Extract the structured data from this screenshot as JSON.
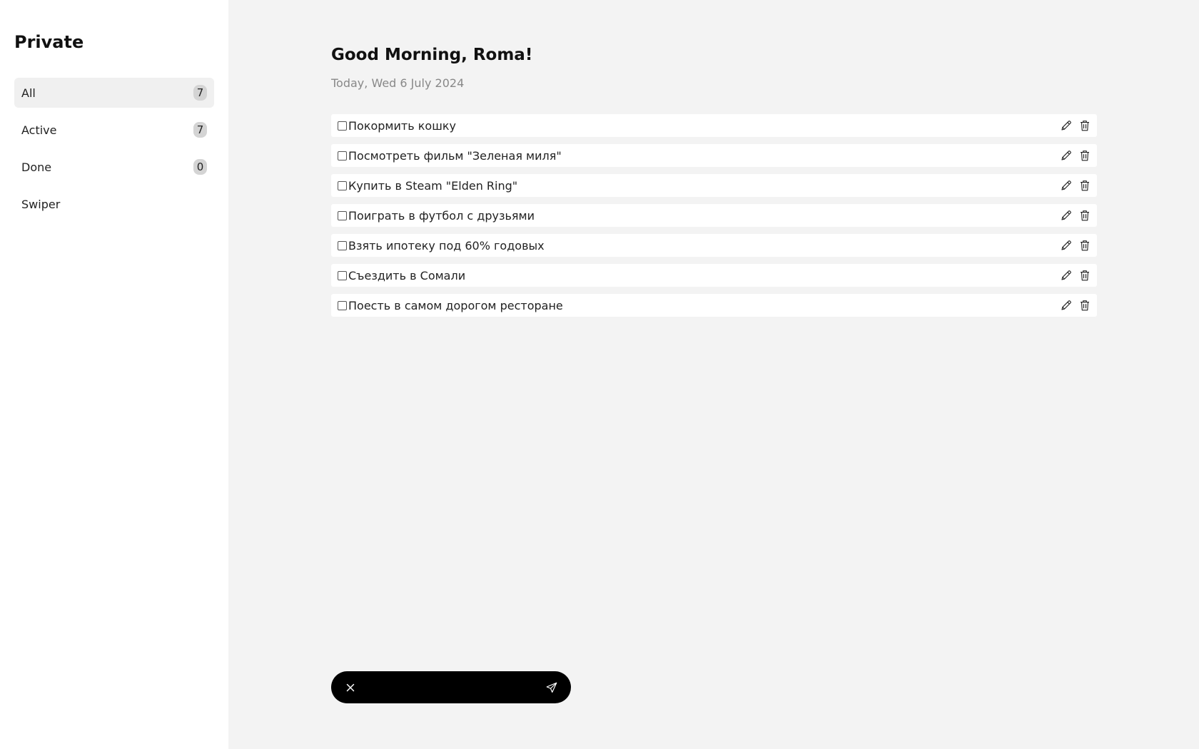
{
  "sidebar": {
    "title": "Private",
    "items": [
      {
        "label": "All",
        "count": "7",
        "active": true
      },
      {
        "label": "Active",
        "count": "7",
        "active": false
      },
      {
        "label": "Done",
        "count": "0",
        "active": false
      },
      {
        "label": "Swiper",
        "count": "",
        "active": false
      }
    ]
  },
  "main": {
    "greeting": "Good Morning, Roma!",
    "date": "Today, Wed 6 July 2024",
    "tasks": [
      {
        "text": "Покормить кошку",
        "done": false
      },
      {
        "text": "Посмотреть фильм \"Зеленая миля\"",
        "done": false
      },
      {
        "text": "Купить в Steam \"Elden Ring\"",
        "done": false
      },
      {
        "text": "Поиграть в футбол с друзьями",
        "done": false
      },
      {
        "text": "Взять ипотеку под 60% годовых",
        "done": false
      },
      {
        "text": "Съездить в Сомали",
        "done": false
      },
      {
        "text": "Поесть в самом дорогом ресторане",
        "done": false
      }
    ]
  },
  "compose": {
    "value": "",
    "placeholder": "",
    "close_icon": "close-icon",
    "send_icon": "send-icon"
  },
  "colors": {
    "background": "#f3f3f3",
    "sidebar": "#ffffff",
    "compose_bg": "#000000"
  }
}
